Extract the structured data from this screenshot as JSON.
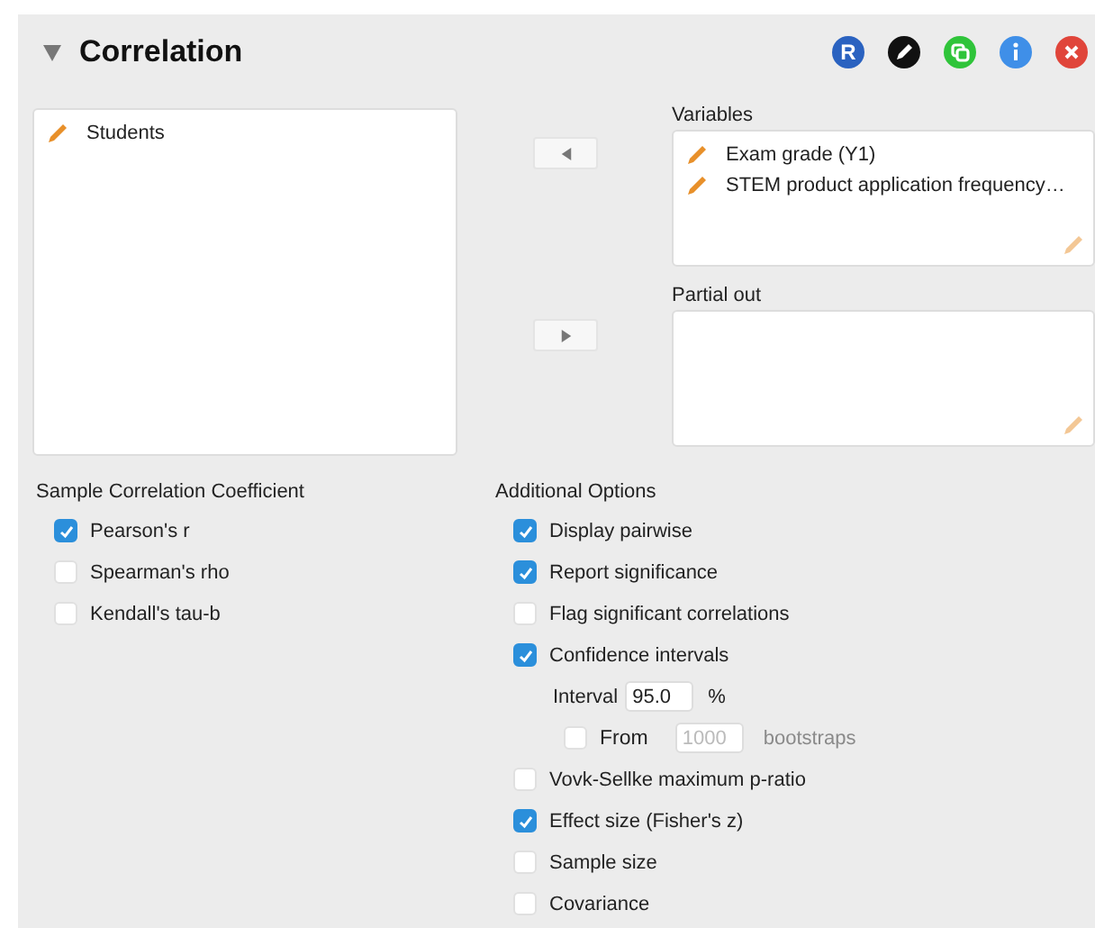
{
  "panel": {
    "title": "Correlation",
    "expanded": true,
    "r_label": "R"
  },
  "available_variables": {
    "items": [
      {
        "name": "Students"
      }
    ]
  },
  "variables": {
    "label": "Variables",
    "items": [
      {
        "name": "Exam grade (Y1)"
      },
      {
        "name": "STEM product application frequency…"
      }
    ]
  },
  "partial_out": {
    "label": "Partial out"
  },
  "sample_correlation_coefficient": {
    "title": "Sample Correlation Coefficient",
    "options": [
      {
        "label": "Pearson's r",
        "checked": true
      },
      {
        "label": "Spearman's rho",
        "checked": false
      },
      {
        "label": "Kendall's tau-b",
        "checked": false
      }
    ]
  },
  "additional_options": {
    "title": "Additional Options",
    "options": [
      {
        "kind": "checkbox",
        "label": "Display pairwise",
        "checked": true
      },
      {
        "kind": "checkbox",
        "label": "Report significance",
        "checked": true
      },
      {
        "kind": "checkbox",
        "label": "Flag significant correlations",
        "checked": false
      },
      {
        "kind": "checkbox",
        "label": "Confidence intervals",
        "checked": true
      },
      {
        "kind": "interval",
        "label": "Interval",
        "value": "95.0",
        "unit": "%"
      },
      {
        "kind": "bootstrap",
        "label": "From",
        "checked": false,
        "value": "1000",
        "unit": "bootstraps",
        "disabled": true
      },
      {
        "kind": "checkbox",
        "label": "Vovk-Sellke maximum p-ratio",
        "checked": false
      },
      {
        "kind": "checkbox",
        "label": "Effect size (Fisher's z)",
        "checked": true
      },
      {
        "kind": "checkbox",
        "label": "Sample size",
        "checked": false
      },
      {
        "kind": "checkbox",
        "label": "Covariance",
        "checked": false
      }
    ]
  }
}
